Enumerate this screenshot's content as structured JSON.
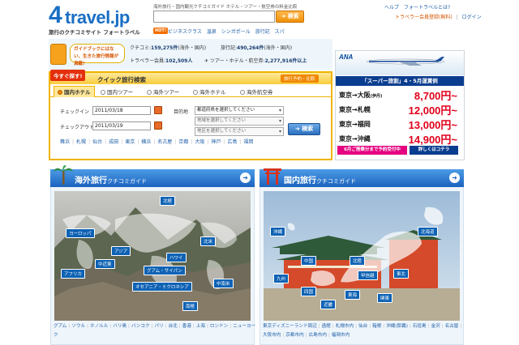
{
  "header": {
    "logo_text": "travel.jp",
    "logo_number": "4",
    "tagline": "旅行のクチコミサイト フォートラベル",
    "headline": "海外旅行・国内観光クチコミガイド ホテル・ツアー・航空券の料金比較",
    "search": {
      "value": "",
      "placeholder": "",
      "button_label": "検索"
    },
    "hot_badge": "HOT!",
    "hot_links": [
      "ビジネスクラス",
      "温泉",
      "シンガポール",
      "旅行記",
      "スパ"
    ],
    "top_links": [
      "ヘルプ",
      "フォートラベルとは?"
    ],
    "register_links": [
      "トラベラー会員登録(無料)",
      "ログイン"
    ],
    "register_separator": "|"
  },
  "band": {
    "promo": "ガイドブックにはない、生きた旅行情報が満載!",
    "stats": [
      {
        "label": "クチコミ:",
        "value": "159,275件"
      },
      {
        "label": "旅行記:",
        "value": "490,264件"
      },
      {
        "label": "トラベラー会員:",
        "value": "102,509人"
      },
      {
        "label": "ツアー・ホテル・航空券:",
        "value": "2,277,916件以上"
      }
    ],
    "stats_suffix": [
      "(海外・国内)",
      "(海外・国内)"
    ]
  },
  "quick_search": {
    "ribbon": "今すぐ探す!",
    "title": "クイック旅行検索",
    "compare_label": "旅行予約・比較",
    "tabs": [
      {
        "label": "国内ホテル",
        "active": true
      },
      {
        "label": "国内ツアー",
        "active": false
      },
      {
        "label": "海外ツアー",
        "active": false
      },
      {
        "label": "海外ホテル",
        "active": false
      },
      {
        "label": "海外航空券",
        "active": false
      }
    ],
    "checkin_label": "チェックイン",
    "checkin_value": "2011/03/18",
    "checkout_label": "チェックアウト",
    "checkout_value": "2011/03/19",
    "destination_label": "目的地",
    "selects": [
      "都道府県を選択してください",
      "地域を選択してください",
      "地区を選択してください"
    ],
    "search_button": "検索",
    "cities": [
      "舞浜",
      "札幌",
      "仙台",
      "成田",
      "東京",
      "横浜",
      "名古屋",
      "京都",
      "大阪",
      "神戸",
      "広島",
      "福岡"
    ]
  },
  "ana_ad": {
    "logo": "ANA",
    "heading": "「スーパー旅割」4・5月運賃例",
    "fares": [
      {
        "from": "東京",
        "to": "大阪",
        "note": "(伊丹)",
        "price": "8,700円~"
      },
      {
        "from": "東京",
        "to": "札幌",
        "note": "",
        "price": "12,000円~"
      },
      {
        "from": "東京",
        "to": "福岡",
        "note": "",
        "price": "13,000円~"
      },
      {
        "from": "東京",
        "to": "沖縄",
        "note": "",
        "price": "14,900円~"
      }
    ],
    "arrow": "→",
    "note": "6月ご搭乗分まで予約受付中",
    "more": "詳しくはコチラ"
  },
  "overseas": {
    "title": "海外旅行",
    "subtitle": "クチコミガイド",
    "tags": [
      "北極",
      "ヨーロッパ",
      "アジア",
      "北米",
      "中近東",
      "ハワイ",
      "グアム・サイパン",
      "アフリカ",
      "オセアニア・ミクロネシア",
      "中南米",
      "南極"
    ],
    "locations": [
      "グアム",
      "ソウル",
      "ホノルル",
      "バリ島",
      "バンコク",
      "パリ",
      "台北",
      "香港",
      "上海",
      "ロンドン",
      "ニューヨーク"
    ]
  },
  "domestic": {
    "title": "国内旅行",
    "subtitle": "クチコミガイド",
    "tags": [
      "沖縄",
      "北海道",
      "中国",
      "北陸",
      "九州",
      "甲信越",
      "東北",
      "四国",
      "近畿",
      "東海",
      "関東"
    ],
    "locations": [
      "東京ディズニーランド周辺",
      "函館",
      "札幌市内",
      "仙台",
      "箱根",
      "沖縄(那覇)",
      "石垣島",
      "金沢",
      "名古屋",
      "大阪市内",
      "京都市内",
      "広島市内",
      "福岡市内"
    ]
  },
  "colors": {
    "brand_blue": "#1a6fc4",
    "accent_orange": "#f08700",
    "price_red": "#e0001b",
    "ana_navy": "#0a3d8f"
  }
}
